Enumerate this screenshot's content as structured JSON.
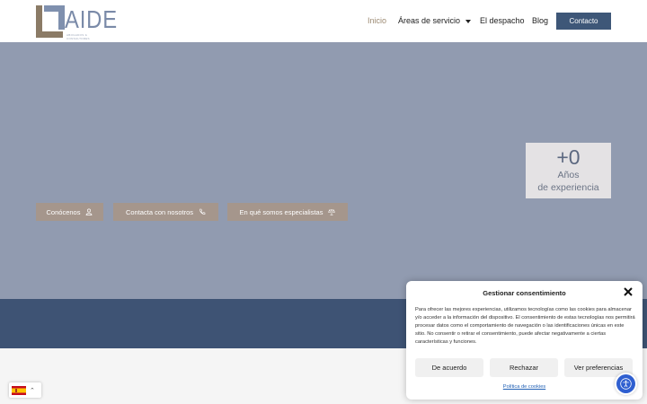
{
  "brand": {
    "name": "AIDE",
    "tagline": "ABOGADOS & CONSULTORES"
  },
  "nav": {
    "items": [
      {
        "label": "Inicio",
        "active": true
      },
      {
        "label": "Áreas de servicio",
        "has_dropdown": true
      },
      {
        "label": "El despacho"
      },
      {
        "label": "Blog"
      }
    ],
    "contact_label": "Contacto"
  },
  "hero": {
    "stat_value": "+0",
    "stat_label_1": "Años",
    "stat_label_2": "de experiencia",
    "buttons": [
      {
        "label": "Conócenos",
        "icon": "person-icon"
      },
      {
        "label": "Contacta con nosotros",
        "icon": "phone-icon"
      },
      {
        "label": "En qué somos especialistas",
        "icon": "scales-icon"
      }
    ]
  },
  "language": {
    "selected": "es",
    "flag": "spain-flag-icon"
  },
  "cookie": {
    "title": "Gestionar consentimiento",
    "body": "Para ofrecer las mejores experiencias, utilizamos tecnologías como las cookies para almacenar y/o acceder a la información del dispositivo. El consentimiento de estas tecnologías nos permitirá procesar datos como el comportamiento de navegación o las identificaciones únicas en este sitio. No consentir o retirar el consentimiento, puede afectar negativamente a ciertas características y funciones.",
    "accept": "De acuerdo",
    "reject": "Rechazar",
    "preferences": "Ver preferencias",
    "policy_link": "Política de cookies"
  },
  "colors": {
    "hero_bg": "#919bb0",
    "band_bg": "#3e5374",
    "accent_btn": "#a5968c",
    "contact_btn": "#3e5778",
    "active_nav": "#9c8a72",
    "a11y_btn": "#2f5fd0"
  }
}
